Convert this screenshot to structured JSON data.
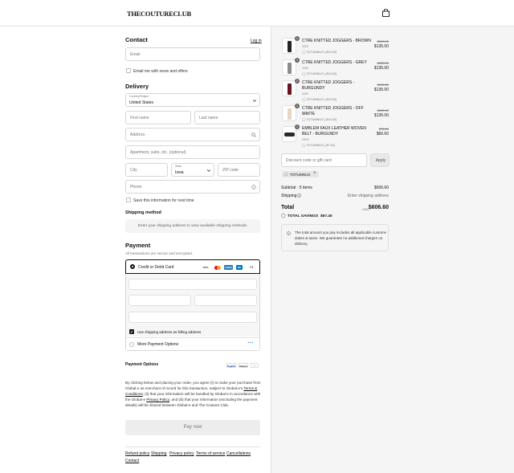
{
  "header": {
    "logo": "THECOUTURECLUB",
    "bag_icon": "shopping-bag-icon"
  },
  "contact": {
    "title": "Contact",
    "login_link": "Log in",
    "email_placeholder": "Email",
    "news_label": "Email me with news and offers"
  },
  "delivery": {
    "title": "Delivery",
    "country_label": "Country/Region",
    "country_value": "United States",
    "first_name": "First name",
    "last_name": "Last name",
    "address": "Address",
    "apartment": "Apartment, suite, etc. (optional)",
    "city": "City",
    "state_label": "State",
    "state_value": "Iowa",
    "zip": "ZIP code",
    "phone": "Phone",
    "save_label": "Save this information for next time"
  },
  "shipping": {
    "title": "Shipping method",
    "info": "Enter your shipping address to view available shipping methods."
  },
  "payment": {
    "title": "Payment",
    "subtitle": "All transactions are secure and encrypted.",
    "card_option": "Credit or Debit Card",
    "card_brands": [
      "VISA",
      "MC",
      "AMEX",
      "DC"
    ],
    "more_brands": "+4",
    "billing_label": "Use shipping address as billing address",
    "more_options": "More Payment Options",
    "options_title": "Payment Options",
    "option_brands": [
      "PayPal",
      "Klarna",
      "..."
    ]
  },
  "legal": {
    "line1": "By clicking below and placing your order, you agree (i) to make your purchase from",
    "line2a": "Global-e as merchant of record for this transaction, subject to Global-e's ",
    "terms_link1": "Terms &",
    "terms_link2": "Conditions",
    "line3": "; (ii) that your information will be handled by Global-e in accordance with",
    "line4a": "the Global-e ",
    "privacy_link": "Privacy Policy",
    "line4b": "; and (iii) that your information (excluding the payment",
    "line5": "details) will be shared between Global-e and The Couture Club."
  },
  "pay_button": "Pay now",
  "footer": {
    "links": [
      "Refund policy",
      "Shipping",
      "Privacy policy",
      "Terms of service",
      "Cancellations"
    ],
    "contact": "Contact"
  },
  "items": [
    {
      "qty": "1",
      "name": "CTRE KNITTED JOGGERS - BROWN",
      "size": "XXS",
      "discount": "TOTUMNUS (-$15.00)",
      "old": "$150.00",
      "new": "$135.00",
      "color": "#2a231e"
    },
    {
      "qty": "1",
      "name": "CTRE KNITTED JOGGERS - GREY",
      "size": "XXS",
      "discount": "TOTUMNUS (-$15.00)",
      "old": "$150.00",
      "new": "$135.00",
      "color": "#8c8c8c"
    },
    {
      "qty": "1",
      "name": "CTRE KNITTED JOGGERS - BURGUNDY",
      "size": "XXS",
      "discount": "TOTUMNUS (-$15.00)",
      "old": "$150.00",
      "new": "$135.00",
      "color": "#6a1420"
    },
    {
      "qty": "1",
      "name": "CTRE KNITTED JOGGERS - OFF WHITE",
      "size": "XXS",
      "discount": "TOTUMNUS (-$15.00)",
      "old": "$150.00",
      "new": "$135.00",
      "color": "#e6d6c2"
    },
    {
      "qty": "1",
      "name": "EMBLEM FAUX LEATHER WOVEN BELT - BURGUNDY",
      "size": "XS/S",
      "discount": "TOTUMNUS (-$7.40)",
      "old": "$74.00",
      "new": "$66.60",
      "color": "#2b2b2b"
    }
  ],
  "discount": {
    "placeholder": "Discount code or gift card",
    "apply": "Apply",
    "applied_code": "TOTUMNUS"
  },
  "summary": {
    "subtotal_label": "Subtotal · 5 items",
    "subtotal_value": "$606.60",
    "shipping_label": "Shipping",
    "shipping_value": "Enter shipping address",
    "total_label": "Total",
    "currency": "USD",
    "total_value": "$606.60",
    "savings_label": "TOTAL SAVINGS",
    "savings_value": "$67.40"
  },
  "notice": "The total amount you pay includes all applicable customs duties & taxes. We guarantee no additional charges on delivery.",
  "colors": {
    "accent": "#111111",
    "visa": "#1a1f71",
    "mc_red": "#eb001b",
    "mc_orange": "#f79e1b",
    "amex": "#2e77bc",
    "dc": "#0079be"
  }
}
